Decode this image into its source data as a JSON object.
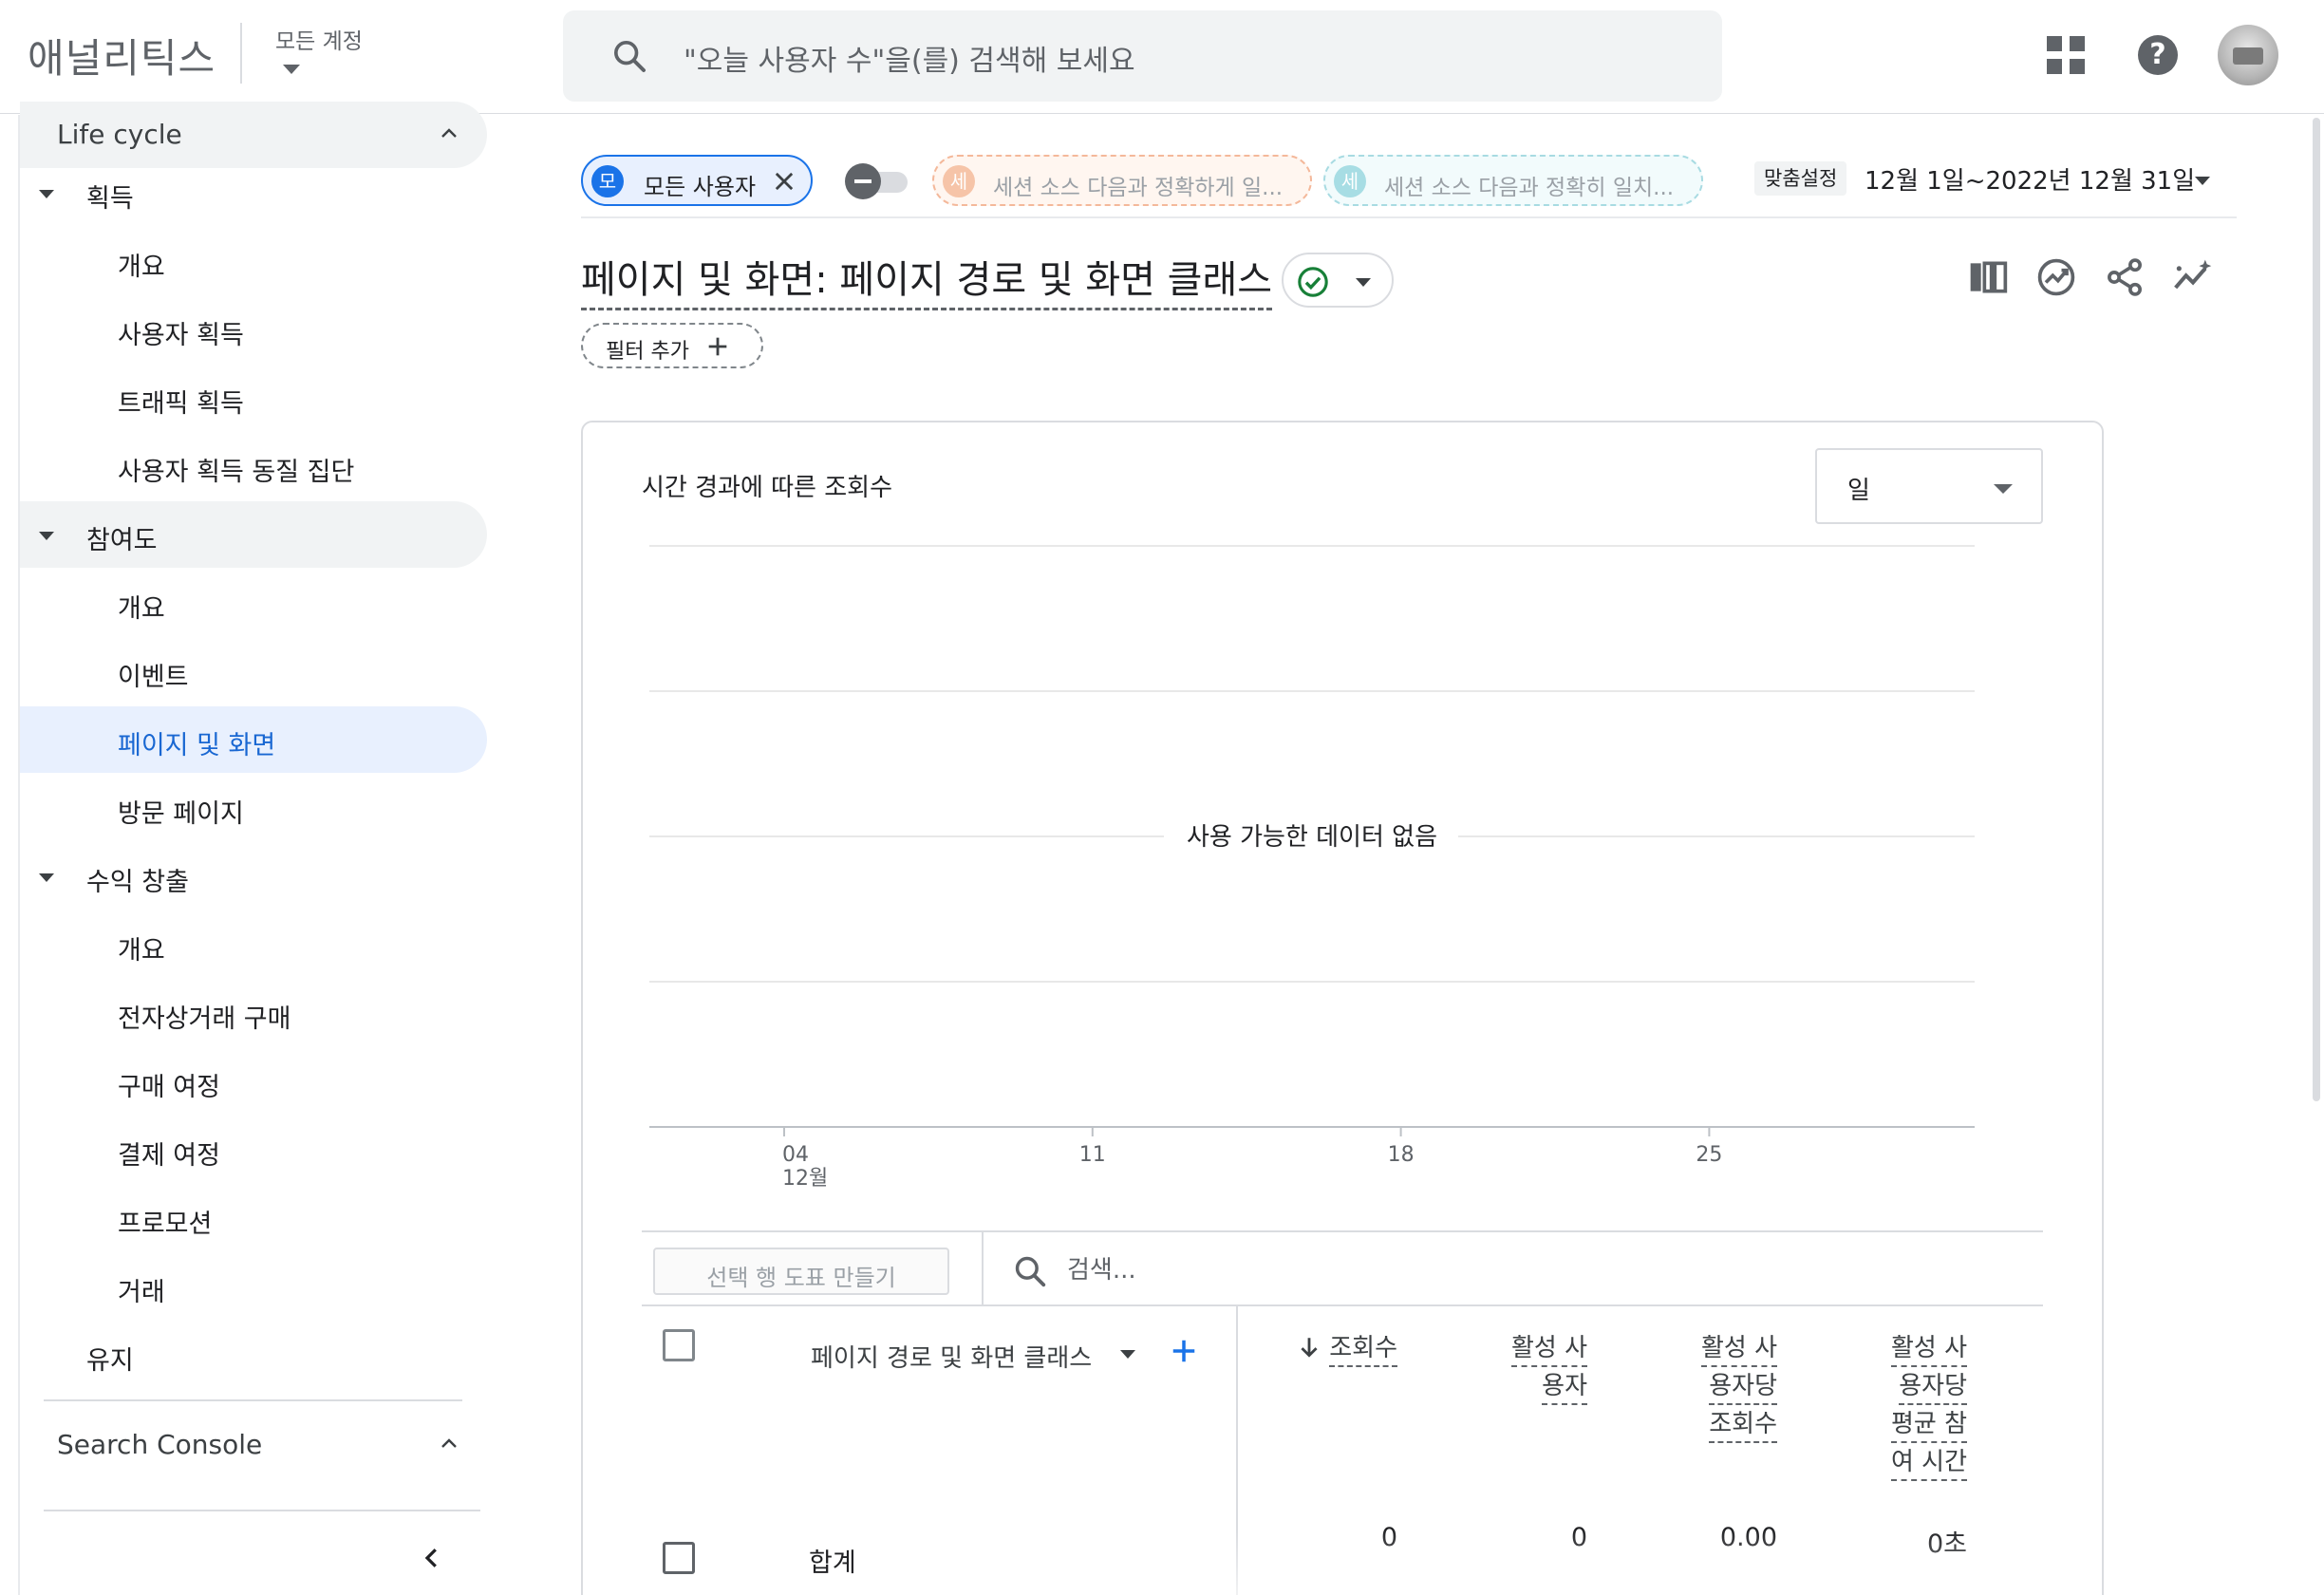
{
  "app": {
    "brand": "애널리틱스",
    "account_label": "모든 계정",
    "search_placeholder": "\"오늘 사용자 수\"을(를) 검색해 보세요"
  },
  "sidebar": {
    "top_section": "Life cycle",
    "groups": [
      {
        "label": "획득",
        "items": [
          "개요",
          "사용자 획득",
          "트래픽 획득",
          "사용자 획득 동질 집단"
        ]
      },
      {
        "label": "참여도",
        "items": [
          "개요",
          "이벤트",
          "페이지 및 화면",
          "방문 페이지"
        ]
      },
      {
        "label": "수익 창출",
        "items": [
          "개요",
          "전자상거래 구매",
          "구매 여정",
          "결제 여정",
          "프로모션",
          "거래"
        ]
      }
    ],
    "retention": "유지",
    "bottom_section": "Search Console",
    "active_item": "페이지 및 화면"
  },
  "filters": {
    "segment_letter": "모",
    "segment_label": "모든 사용자",
    "compare1_letter": "세",
    "compare1_label": "세션 소스 다음과 정확하게 일...",
    "compare2_letter": "세",
    "compare2_label": "세션 소스 다음과 정확히 일치...",
    "date_badge": "맞춤설정",
    "date_range": "12월 1일~2022년 12월 31일"
  },
  "report": {
    "title": "페이지 및 화면: 페이지 경로 및 화면 클래스",
    "add_filter": "필터 추가",
    "tools": [
      "compare-columns-icon",
      "insights-icon",
      "share-icon",
      "anomaly-icon"
    ]
  },
  "chart_data": {
    "type": "line",
    "title": "시간 경과에 따른 조회수",
    "granularity": "일",
    "x_ticks": [
      "04",
      "11",
      "18",
      "25"
    ],
    "x_month_label": "12월",
    "series": [],
    "empty_message": "사용 가능한 데이터 없음",
    "grid": true
  },
  "table": {
    "plot_rows_label": "선택 행 도표 만들기",
    "search_placeholder": "검색...",
    "dimension_header": "페이지 경로 및 화면 클래스",
    "metric_headers": [
      [
        "조회수"
      ],
      [
        "활성 사",
        "용자"
      ],
      [
        "활성 사",
        "용자당",
        "조회수"
      ],
      [
        "활성 사",
        "용자당",
        "평균 참",
        "여 시간"
      ]
    ],
    "total_label": "합계",
    "totals": [
      "0",
      "0",
      "0.00",
      "0초"
    ]
  },
  "colors": {
    "accent": "#1a73e8",
    "active_nav_bg": "#e8f0fe",
    "status_ok": "#188038"
  }
}
